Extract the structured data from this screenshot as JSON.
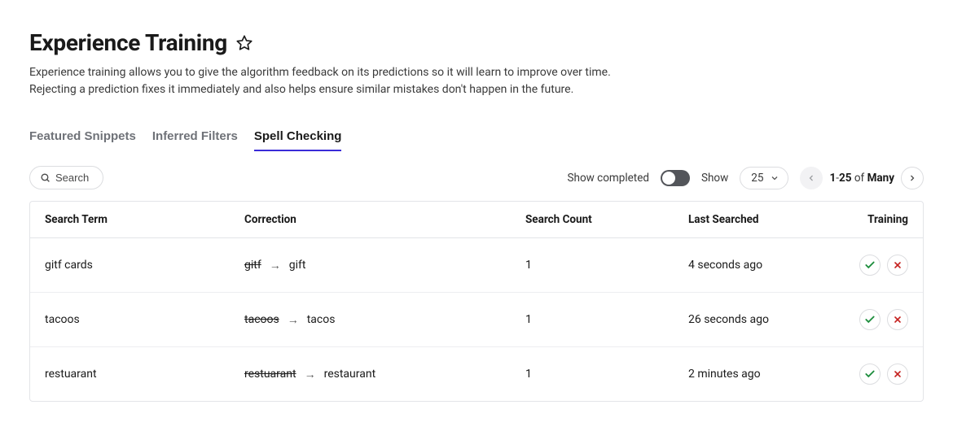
{
  "header": {
    "title": "Experience Training",
    "desc1": "Experience training allows you to give the algorithm feedback on its predictions so it will learn to improve over time.",
    "desc2": "Rejecting a prediction fixes it immediately and also helps ensure similar mistakes don't happen in the future."
  },
  "tabs": [
    {
      "label": "Featured Snippets",
      "active": false
    },
    {
      "label": "Inferred Filters",
      "active": false
    },
    {
      "label": "Spell Checking",
      "active": true
    }
  ],
  "toolbar": {
    "search_placeholder": "Search",
    "show_completed_label": "Show completed",
    "show_label": "Show",
    "page_size": "25",
    "pager_from": "1",
    "pager_to": "25",
    "pager_of": "of",
    "pager_total": "Many"
  },
  "table": {
    "columns": {
      "search_term": "Search Term",
      "correction": "Correction",
      "search_count": "Search Count",
      "last_searched": "Last Searched",
      "training": "Training"
    },
    "rows": [
      {
        "term": "gitf cards",
        "wrong": "gitf",
        "right": "gift",
        "count": "1",
        "last": "4 seconds ago"
      },
      {
        "term": "tacoos",
        "wrong": "tacoos",
        "right": "tacos",
        "count": "1",
        "last": "26 seconds ago"
      },
      {
        "term": "restuarant",
        "wrong": "restuarant",
        "right": "restaurant",
        "count": "1",
        "last": "2 minutes ago"
      }
    ]
  }
}
